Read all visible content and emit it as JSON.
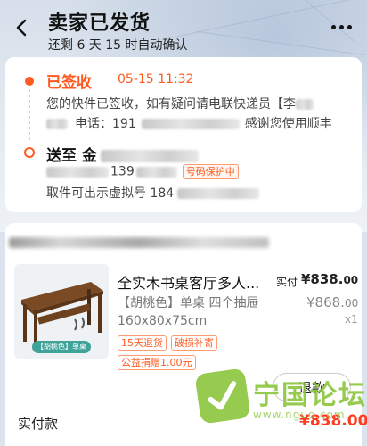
{
  "header": {
    "title": "卖家已发货",
    "subtitle": "还剩 6 天 15 时自动确认"
  },
  "logistics": {
    "status": "已签收",
    "time": "05-15 11:32",
    "line1": "您的快件已签收，如有疑问请电联快递员【李",
    "line2_prefix": "电话：191",
    "line2_suffix": "感谢您使用顺丰",
    "dest_label": "送至 金",
    "phone_partial": "139",
    "privacy_tag": "号码保护中",
    "virtual_prefix": "取件可出示虚拟号 184"
  },
  "order": {
    "product_title": "全实木书桌客厅多人...",
    "sku": "【胡桃色】单桌 四个抽屉 160x80x75cm",
    "image_caption": "【胡桃色】单桌",
    "tags": [
      "15天退货",
      "破损补寄",
      "公益捐赠1.00元"
    ],
    "paid_label": "实付",
    "paid_price_main": "¥838.",
    "paid_price_cents": "00",
    "orig_price_main": "¥868.",
    "orig_price_cents": "00",
    "quantity": "x1",
    "refund_button": "退款",
    "total_label": "实付款",
    "total_price": "¥838.00"
  },
  "watermark": {
    "text": "宁国论坛",
    "url": "www.nguo.com"
  },
  "colors": {
    "accent": "#ff5a1f",
    "price_red": "#ff3b1f",
    "watermark_green": "#8cc63e"
  }
}
